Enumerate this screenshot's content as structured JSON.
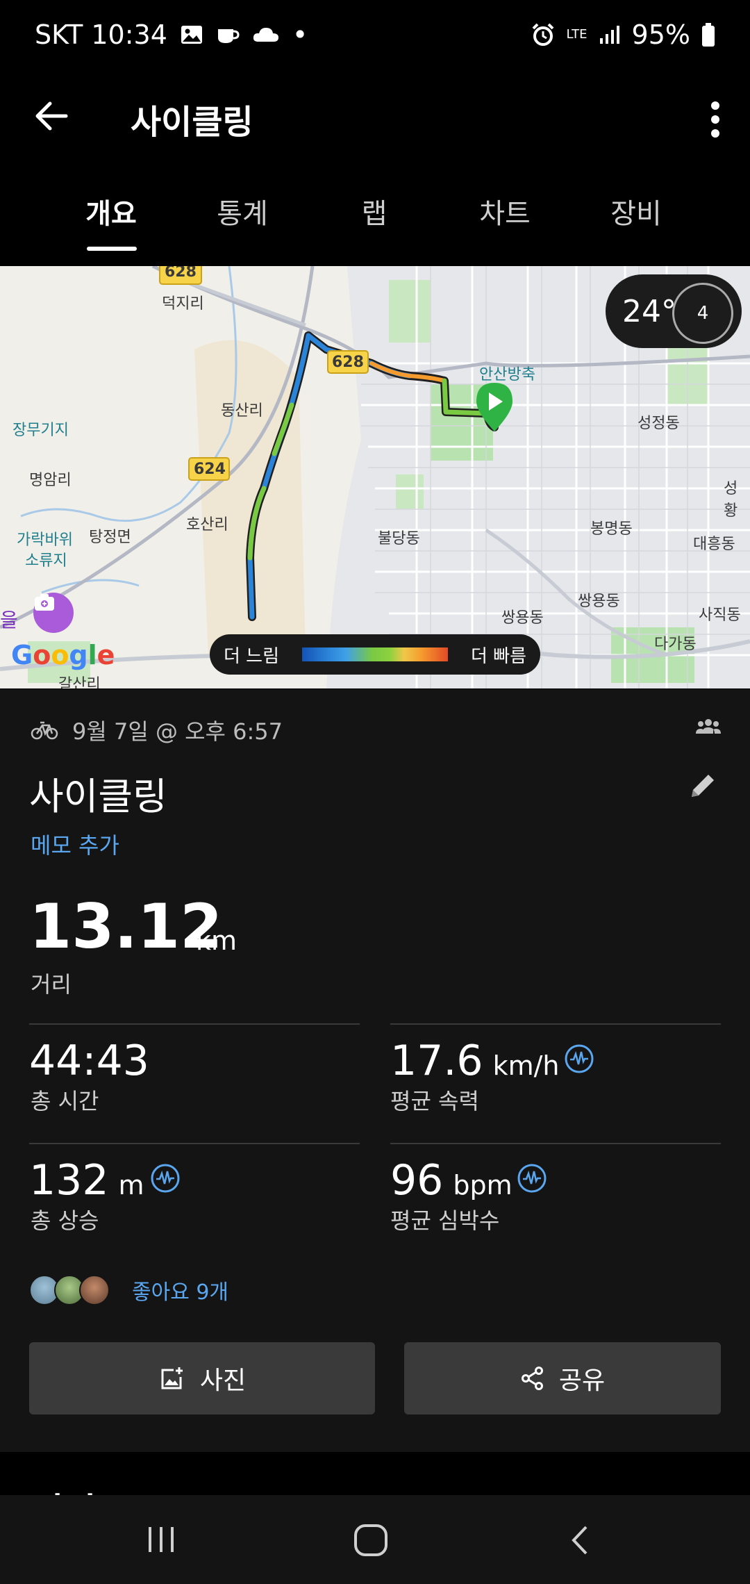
{
  "status_bar": {
    "carrier_time": "SKT 10:34",
    "dot": "•",
    "network": "LTE",
    "battery": "95%"
  },
  "app_bar": {
    "title": "사이클링",
    "back_icon": "arrow-left-icon",
    "more_icon": "more-vert-icon"
  },
  "tabs": [
    {
      "label": "개요",
      "active": true
    },
    {
      "label": "통계",
      "active": false
    },
    {
      "label": "랩",
      "active": false
    },
    {
      "label": "차트",
      "active": false
    },
    {
      "label": "장비",
      "active": false
    }
  ],
  "map": {
    "weather": {
      "temp": "24°",
      "badge": "4"
    },
    "legend": {
      "slow": "더 느림",
      "fast": "더 빠름"
    },
    "google_logo": "Google",
    "labels": {
      "road_628_a": "628",
      "road_628_b": "628",
      "road_624": "624",
      "deokjiri": "덕지리",
      "ansan": "안산방축",
      "jangmugiji": "장무기지",
      "dongsanri": "동산리",
      "seongjeongdong": "성정동",
      "myeongamri": "명암리",
      "hosanri": "호산리",
      "gharakbawi": "가락바위",
      "soryuji": "소류지",
      "tangjeongmyeon": "탕정면",
      "buldangdong": "불당동",
      "bongmyeongdong": "봉명동",
      "daeheungdong": "대흥동",
      "ssangyongdong_a": "쌍용동",
      "ssangyongdong_b": "쌍용동",
      "sajikdong": "사직동",
      "dagadong": "다가동",
      "galsanri": "갈산리",
      "seong_edge": "성황",
      "eul_edge": "을"
    }
  },
  "activity": {
    "meta": "9월 7일 @ 오후 6:57",
    "title": "사이클링",
    "memo": "메모 추가",
    "distance": {
      "value": "13.12",
      "unit": "km",
      "label": "거리"
    },
    "stats": [
      {
        "value": "44:43",
        "unit": "",
        "label": "총 시간"
      },
      {
        "value": "17.6",
        "unit": "km/h",
        "label": "평균 속력"
      },
      {
        "value": "132",
        "unit": "m",
        "label": "총 상승"
      },
      {
        "value": "96",
        "unit": "bpm",
        "label": "평균 심박수"
      }
    ],
    "likes": "좋아요 9개",
    "buttons": {
      "photo": "사진",
      "share": "공유"
    }
  },
  "next_section": {
    "title": "평가"
  },
  "colors": {
    "accent_blue": "#5aa7f0",
    "route_green": "#7ac943",
    "route_blue": "#2c84d8",
    "start_green": "#2fb344",
    "camera_purple": "#a95bd9"
  }
}
